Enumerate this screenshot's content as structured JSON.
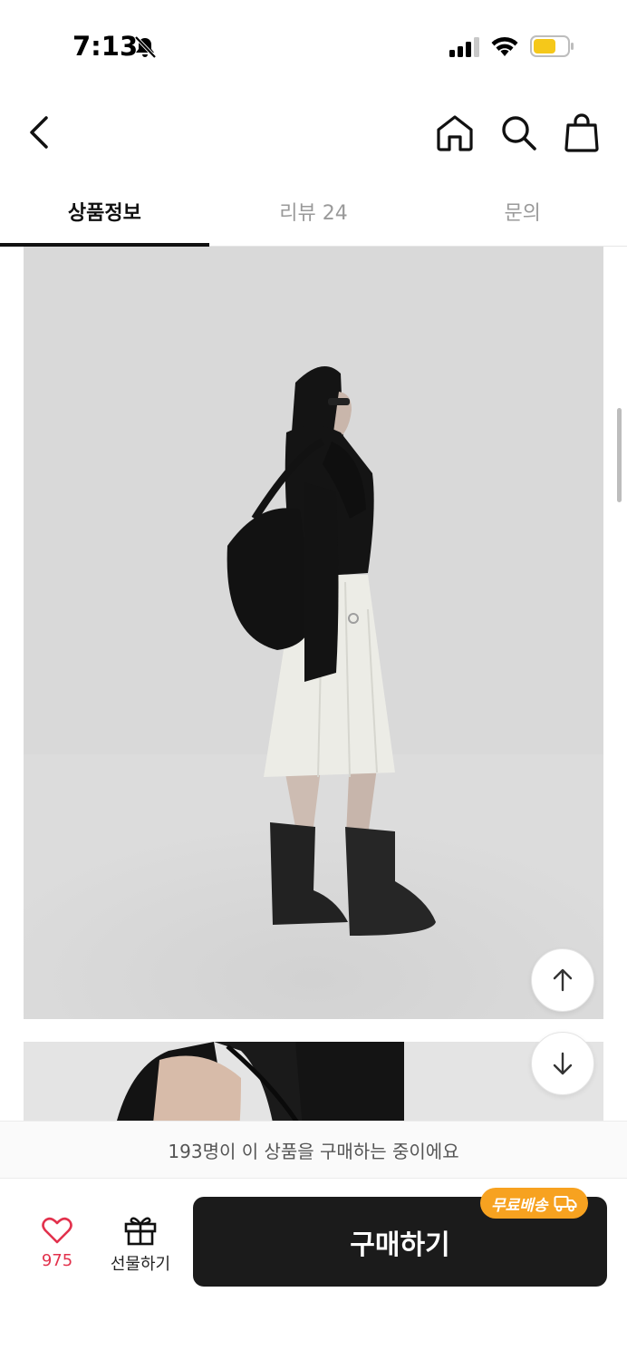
{
  "status_bar": {
    "time": "7:13",
    "icons": [
      "bell-slash-icon",
      "cellular-signal-icon",
      "wifi-icon",
      "battery-icon"
    ],
    "battery_color": "#f5c81a"
  },
  "nav": {
    "icons": [
      "back-chevron-icon",
      "home-icon",
      "search-icon",
      "shopping-bag-icon"
    ]
  },
  "tabs": [
    {
      "label": "상품정보",
      "active": true
    },
    {
      "label": "리뷰 24",
      "active": false
    },
    {
      "label": "문의",
      "active": false
    }
  ],
  "content": {
    "images": [
      "product-photo-full-outfit",
      "product-photo-detail"
    ],
    "scroll_buttons": [
      "arrow-up-icon",
      "arrow-down-icon"
    ]
  },
  "notice": {
    "text": "193명이 이 상품을 구매하는 중이에요"
  },
  "bottom_bar": {
    "like_count": "975",
    "gift_label": "선물하기",
    "buy_label": "구매하기",
    "badge_label": "무료배송",
    "like_color": "#e2314c",
    "badge_color": "#f7a220",
    "button_color": "#1b1b1b"
  }
}
